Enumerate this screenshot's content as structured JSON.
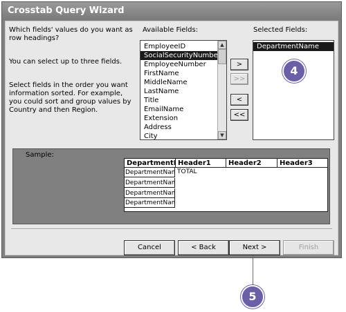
{
  "window": {
    "title": "Crosstab Query Wizard"
  },
  "instructions": {
    "line1": "Which fields' values do you want as row headings?",
    "line2": "You can select up to three fields.",
    "line3": "Select fields in the order you want information sorted.  For example, you could sort and group values by Country and then Region."
  },
  "available": {
    "label": "Available Fields:",
    "items": [
      "EmployeeID",
      "SocialSecurityNumber",
      "EmployeeNumber",
      "FirstName",
      "MiddleName",
      "LastName",
      "Title",
      "EmailName",
      "Extension",
      "Address",
      "City"
    ],
    "selected_index": 1
  },
  "selected": {
    "label": "Selected Fields:",
    "items": [
      "DepartmentName"
    ]
  },
  "move_buttons": {
    "add": ">",
    "add_all": ">>",
    "remove": "<",
    "remove_all": "<<"
  },
  "sample": {
    "label": "Sample:",
    "headers": [
      "DepartmentN",
      "Header1",
      "Header2",
      "Header3"
    ],
    "rows": [
      "DepartmentNam",
      "DepartmentNam",
      "DepartmentNam",
      "DepartmentNam"
    ],
    "total": "TOTAL"
  },
  "buttons": {
    "cancel": "Cancel",
    "back": "< Back",
    "next": "Next >",
    "finish": "Finish"
  },
  "callouts": {
    "step4": "4",
    "step5": "5"
  }
}
